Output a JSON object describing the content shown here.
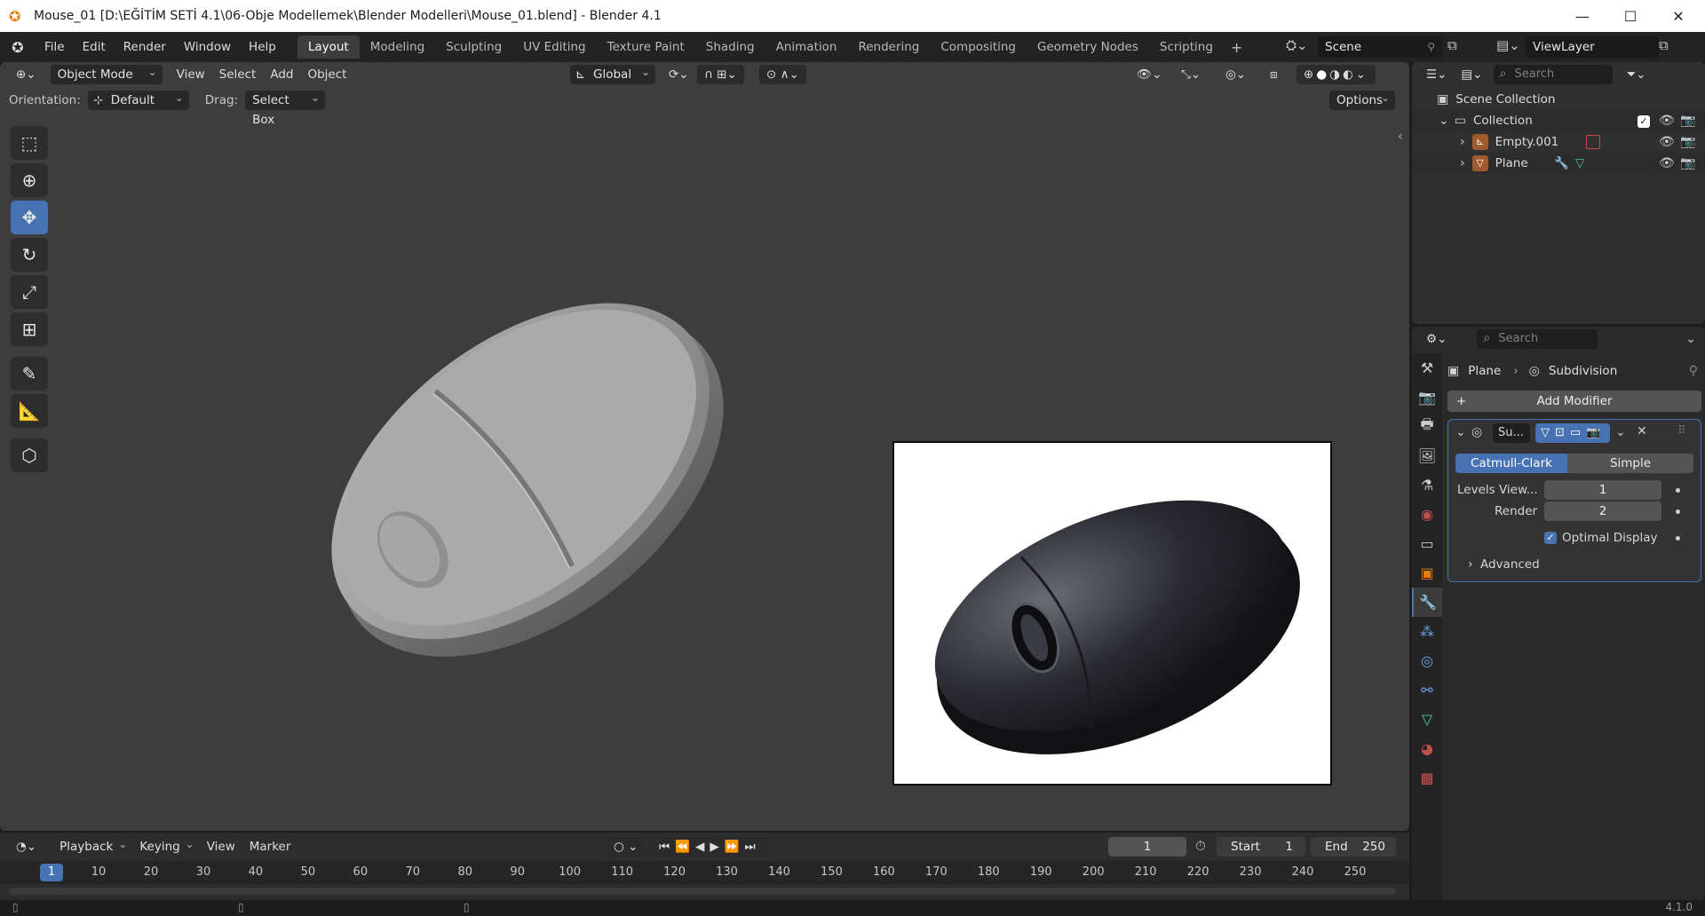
{
  "window": {
    "title": "Mouse_01 [D:\\EĞİTİM SETİ 4.1\\06-Obje Modellemek\\Blender Modelleri\\Mouse_01.blend] - Blender 4.1",
    "minimize": "—",
    "maximize": "☐",
    "close": "✕"
  },
  "menus": [
    "File",
    "Edit",
    "Render",
    "Window",
    "Help"
  ],
  "workspaces": [
    {
      "label": "Layout",
      "active": true
    },
    {
      "label": "Modeling"
    },
    {
      "label": "Sculpting"
    },
    {
      "label": "UV Editing"
    },
    {
      "label": "Texture Paint"
    },
    {
      "label": "Shading"
    },
    {
      "label": "Animation"
    },
    {
      "label": "Rendering"
    },
    {
      "label": "Compositing"
    },
    {
      "label": "Geometry Nodes"
    },
    {
      "label": "Scripting"
    }
  ],
  "workspace_add": "+",
  "scene": {
    "label": "Scene",
    "view_layer": "ViewLayer"
  },
  "viewport": {
    "mode": "Object Mode",
    "menus": [
      "View",
      "Select",
      "Add",
      "Object"
    ],
    "transform_orientation": "Global",
    "orientation_label": "Orientation:",
    "orientation_value": "Default",
    "drag_label": "Drag:",
    "drag_value": "Select Box",
    "options": "Options",
    "tools": [
      "select-box",
      "cursor",
      "move",
      "rotate",
      "scale",
      "transform",
      "annotate",
      "measure",
      "add-cube"
    ]
  },
  "timeline": {
    "menus": [
      "Playback",
      "Keying",
      "View",
      "Marker"
    ],
    "current_frame": "1",
    "start_label": "Start",
    "start": "1",
    "end_label": "End",
    "end": "250",
    "ruler": [
      1,
      10,
      20,
      30,
      40,
      50,
      60,
      70,
      80,
      90,
      100,
      110,
      120,
      130,
      140,
      150,
      160,
      170,
      180,
      190,
      200,
      210,
      220,
      230,
      240,
      250
    ]
  },
  "outliner": {
    "search_placeholder": "Search",
    "scene_collection": "Scene Collection",
    "collection": "Collection",
    "items": [
      {
        "name": "Empty.001"
      },
      {
        "name": "Plane"
      }
    ]
  },
  "properties": {
    "search_placeholder": "Search",
    "breadcrumb_object": "Plane",
    "breadcrumb_modifier": "Subdivision",
    "add_modifier": "Add Modifier",
    "modifier_name": "Su...",
    "algo_catmull": "Catmull-Clark",
    "algo_simple": "Simple",
    "levels_label": "Levels View...",
    "levels_value": "1",
    "render_label": "Render",
    "render_value": "2",
    "optimal_display": "Optimal Display",
    "advanced": "Advanced"
  },
  "status": {
    "version": "4.1.0"
  },
  "colors": {
    "accent": "#4772b3",
    "viewport_bg": "#3d3d3d"
  }
}
